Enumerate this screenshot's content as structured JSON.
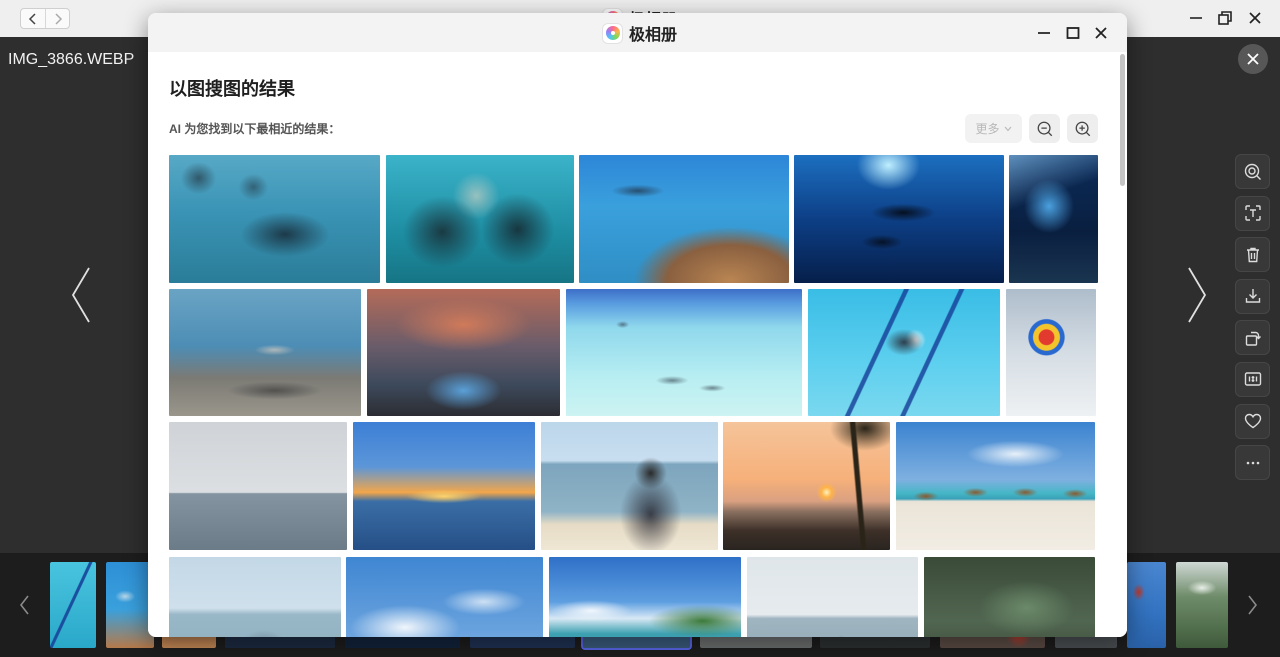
{
  "app": {
    "title": "极相册"
  },
  "viewer": {
    "filename": "IMG_3866.WEBP",
    "side_toolbar_icons": [
      "image-search-icon",
      "text-recognition-icon",
      "trash-icon",
      "download-icon",
      "rotate-icon",
      "actual-size-icon",
      "heart-icon",
      "more-icon"
    ]
  },
  "dialog": {
    "title": "极相册",
    "heading": "以图搜图的结果",
    "subtitle": "AI 为您找到以下最相近的结果：",
    "more_label": "更多",
    "more_disabled": true
  },
  "colors": {
    "viewer_background": "#2e2e2e",
    "filmstrip_background": "#1d1d1d",
    "selected_thumbnail_border": "#5965e8",
    "dialog_background": "#ffffff"
  }
}
